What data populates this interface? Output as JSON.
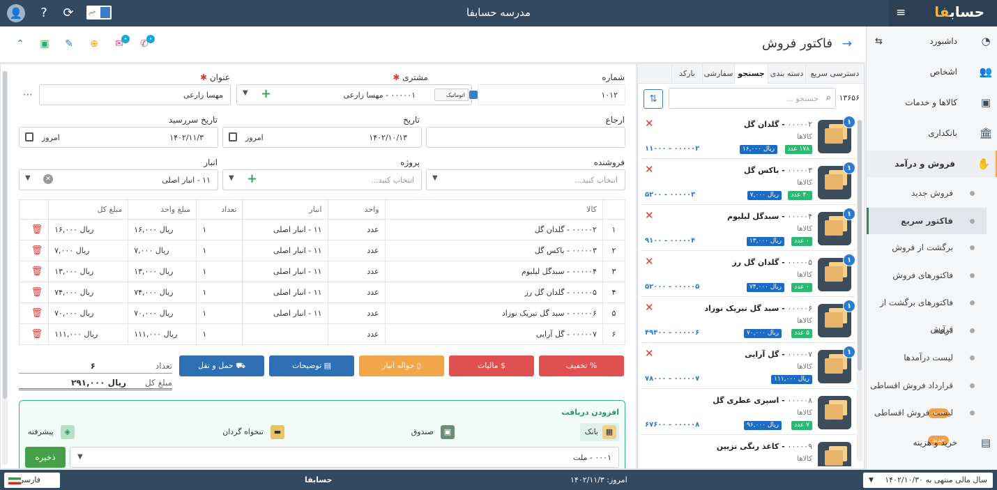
{
  "topbar": {
    "title": "مدرسه حسابفا",
    "logo_main": "حساب",
    "logo_accent": "فا",
    "toggle_label": "خیر"
  },
  "page": {
    "title": "فاکتور فروش"
  },
  "sidebar": {
    "items": [
      {
        "label": "داشبورد",
        "icon": "◔"
      },
      {
        "label": "اشخاص",
        "icon": "👥"
      },
      {
        "label": "کالاها و خدمات",
        "icon": "▣"
      },
      {
        "label": "بانکداری",
        "icon": "🏛"
      },
      {
        "label": "فروش و درآمد",
        "icon": "✋"
      }
    ],
    "subitems": [
      "فروش جدید",
      "فاکتور سریع",
      "برگشت از فروش",
      "فاکتورهای فروش",
      "فاکتورهای برگشت از فروش",
      "درآمد",
      "لیست درآمدها",
      "قرارداد فروش اقساطی",
      "لیست فروش اقساطی"
    ],
    "badge": "جدید",
    "bottom": "خرید و هزینه"
  },
  "panel": {
    "tabs": [
      "دسترسی سریع",
      "دسته بندی",
      "جستجو",
      "سفارشی",
      "بارکد"
    ],
    "search_placeholder": "جستجو ...",
    "count": "۱۳۶۵۶",
    "products": [
      {
        "code": "۰۰۰۰۰۲",
        "name": "گلدان گل",
        "cat": "کالاها",
        "stock": "۱۷۸ عدد",
        "price": "ریال ۱۶,۰۰۰",
        "barcode": "۱۱۰۰۰ - ۰۰۰۰۰۲",
        "qty": "۱"
      },
      {
        "code": "۰۰۰۰۰۳",
        "name": "باکس گل",
        "cat": "کالاها",
        "stock": "۴۰ عدد",
        "price": "ریال ۷,۰۰۰",
        "barcode": "۵۲۰۰ - ۰۰۰۰۰۳",
        "qty": "۱"
      },
      {
        "code": "۰۰۰۰۰۴",
        "name": "سبدگل لیلیوم",
        "cat": "کالاها",
        "stock": "۰ عدد",
        "price": "ریال ۱۳,۰۰۰",
        "barcode": "۹۱۰۰ - ۰۰۰۰۰۴",
        "qty": "۱"
      },
      {
        "code": "۰۰۰۰۰۵",
        "name": "گلدان گل رز",
        "cat": "کالاها",
        "stock": "۰ عدد",
        "price": "ریال ۷۴,۰۰۰",
        "barcode": "۵۲۰۰۰ - ۰۰۰۰۰۵",
        "qty": "۱"
      },
      {
        "code": "۰۰۰۰۰۶",
        "name": "سبد گل تبریک نوزاد",
        "cat": "کالاها",
        "stock": "۵ عدد",
        "price": "ریال ۷۰,۰۰۰",
        "barcode": "۴۹۴۰۰ - ۰۰۰۰۰۶",
        "qty": "۱"
      },
      {
        "code": "۰۰۰۰۰۷",
        "name": "گل آرایی",
        "cat": "کالاها",
        "stock": "",
        "price": "ریال ۱۱۱,۰۰۰",
        "barcode": "۷۸۰۰۰ - ۰۰۰۰۰۷",
        "qty": "۱"
      },
      {
        "code": "۰۰۰۰۰۸",
        "name": "اسپری عطری گل",
        "cat": "کالاها",
        "stock": "۷ عدد",
        "price": "ریال ۹۶,۰۰۰",
        "barcode": "۶۷۶۰۰ - ۰۰۰۰۰۸",
        "qty": ""
      },
      {
        "code": "۰۰۰۰۰۹",
        "name": "کاغذ رنگی تزیین",
        "cat": "کالاها",
        "stock": "",
        "price": "",
        "barcode": "",
        "qty": ""
      }
    ]
  },
  "form": {
    "number_label": "شماره",
    "number_value": "۱۰۱۲",
    "customer_label": "مشتری",
    "customer_value": "۰۰۰۰۰۱ - مهسا زارعی",
    "auto_label": "اتوماتیک",
    "title_label": "عنوان",
    "title_value": "مهسا زارعی",
    "ref_label": "ارجاع",
    "date_label": "تاریخ",
    "date_value": "۱۴۰۲/۱۰/۱۳",
    "due_label": "تاریخ سررسید",
    "due_value": "۱۴۰۲/۱۱/۳",
    "today": "امروز",
    "seller_label": "فروشنده",
    "seller_placeholder": "انتخاب کنید...",
    "project_label": "پروژه",
    "project_placeholder": "انتخاب کنید...",
    "warehouse_label": "انبار",
    "warehouse_value": "۱۱ - انبار اصلی"
  },
  "table": {
    "headers": [
      "",
      "کالا",
      "واحد",
      "انبار",
      "تعداد",
      "مبلغ واحد",
      "مبلغ کل",
      ""
    ],
    "rows": [
      [
        "۱",
        "۰۰۰۰۰۲ - گلدان گل",
        "عدد",
        "۱۱ - انبار اصلی",
        "۱",
        "ریال ۱۶,۰۰۰",
        "ریال ۱۶,۰۰۰"
      ],
      [
        "۲",
        "۰۰۰۰۰۳ - باکس گل",
        "عدد",
        "۱۱ - انبار اصلی",
        "۱",
        "ریال ۷,۰۰۰",
        "ریال ۷,۰۰۰"
      ],
      [
        "۳",
        "۰۰۰۰۰۴ - سبدگل لیلیوم",
        "عدد",
        "۱۱ - انبار اصلی",
        "۱",
        "ریال ۱۳,۰۰۰",
        "ریال ۱۳,۰۰۰"
      ],
      [
        "۴",
        "۰۰۰۰۰۵ - گلدان گل رز",
        "عدد",
        "۱۱ - انبار اصلی",
        "۱",
        "ریال ۷۴,۰۰۰",
        "ریال ۷۴,۰۰۰"
      ],
      [
        "۵",
        "۰۰۰۰۰۶ - سبد گل تبریک نوزاد",
        "عدد",
        "۱۱ - انبار اصلی",
        "۱",
        "ریال ۷۰,۰۰۰",
        "ریال ۷۰,۰۰۰"
      ],
      [
        "۶",
        "۰۰۰۰۰۷ - گل آرایی",
        "عدد",
        "",
        "۱",
        "ریال ۱۱۱,۰۰۰",
        "ریال ۱۱۱,۰۰۰"
      ]
    ]
  },
  "actions": {
    "discount": "تخفیف",
    "tax": "مالیات",
    "warehouse": "حواله انبار",
    "notes": "توضیحات",
    "shipping": "حمل و نقل"
  },
  "summary": {
    "count_label": "تعداد",
    "count_value": "۶",
    "total_label": "مبلغ کل",
    "total_value": "ریال ۲۹۱,۰۰۰"
  },
  "receive": {
    "title": "افزودن دریافت",
    "bank": "بانک",
    "cashbox": "صندوق",
    "petty": "تنخواه گردان",
    "advanced": "پیشرفته",
    "account": "۰۰۰۱ - ملت",
    "save": "ذخیره"
  },
  "footer": {
    "language": "فارسی",
    "app": "حسابفا",
    "today": "امروز: ۱۴۰۲/۱۱/۳",
    "fiscal_year": "سال مالی منتهی به ۱۴۰۲/۱۰/۳۰"
  },
  "colors": {
    "topbar": "#33495f",
    "discount": "#e15050",
    "tax": "#e15050",
    "warehouse": "#f3a54a",
    "notes": "#2f6fb4",
    "shipping": "#2f6fb4",
    "save": "#43a047"
  }
}
